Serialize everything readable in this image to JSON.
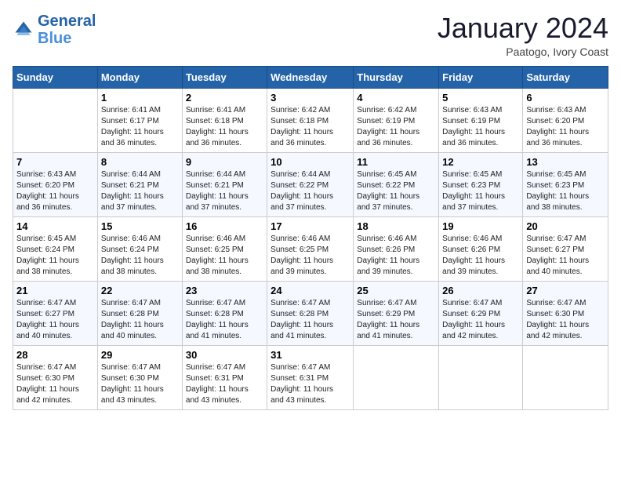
{
  "header": {
    "logo_line1": "General",
    "logo_line2": "Blue",
    "title": "January 2024",
    "subtitle": "Paatogo, Ivory Coast"
  },
  "days_of_week": [
    "Sunday",
    "Monday",
    "Tuesday",
    "Wednesday",
    "Thursday",
    "Friday",
    "Saturday"
  ],
  "weeks": [
    [
      {
        "day": "",
        "sunrise": "",
        "sunset": "",
        "daylight": ""
      },
      {
        "day": "1",
        "sunrise": "Sunrise: 6:41 AM",
        "sunset": "Sunset: 6:17 PM",
        "daylight": "Daylight: 11 hours and 36 minutes."
      },
      {
        "day": "2",
        "sunrise": "Sunrise: 6:41 AM",
        "sunset": "Sunset: 6:18 PM",
        "daylight": "Daylight: 11 hours and 36 minutes."
      },
      {
        "day": "3",
        "sunrise": "Sunrise: 6:42 AM",
        "sunset": "Sunset: 6:18 PM",
        "daylight": "Daylight: 11 hours and 36 minutes."
      },
      {
        "day": "4",
        "sunrise": "Sunrise: 6:42 AM",
        "sunset": "Sunset: 6:19 PM",
        "daylight": "Daylight: 11 hours and 36 minutes."
      },
      {
        "day": "5",
        "sunrise": "Sunrise: 6:43 AM",
        "sunset": "Sunset: 6:19 PM",
        "daylight": "Daylight: 11 hours and 36 minutes."
      },
      {
        "day": "6",
        "sunrise": "Sunrise: 6:43 AM",
        "sunset": "Sunset: 6:20 PM",
        "daylight": "Daylight: 11 hours and 36 minutes."
      }
    ],
    [
      {
        "day": "7",
        "sunrise": "Sunrise: 6:43 AM",
        "sunset": "Sunset: 6:20 PM",
        "daylight": "Daylight: 11 hours and 36 minutes."
      },
      {
        "day": "8",
        "sunrise": "Sunrise: 6:44 AM",
        "sunset": "Sunset: 6:21 PM",
        "daylight": "Daylight: 11 hours and 37 minutes."
      },
      {
        "day": "9",
        "sunrise": "Sunrise: 6:44 AM",
        "sunset": "Sunset: 6:21 PM",
        "daylight": "Daylight: 11 hours and 37 minutes."
      },
      {
        "day": "10",
        "sunrise": "Sunrise: 6:44 AM",
        "sunset": "Sunset: 6:22 PM",
        "daylight": "Daylight: 11 hours and 37 minutes."
      },
      {
        "day": "11",
        "sunrise": "Sunrise: 6:45 AM",
        "sunset": "Sunset: 6:22 PM",
        "daylight": "Daylight: 11 hours and 37 minutes."
      },
      {
        "day": "12",
        "sunrise": "Sunrise: 6:45 AM",
        "sunset": "Sunset: 6:23 PM",
        "daylight": "Daylight: 11 hours and 37 minutes."
      },
      {
        "day": "13",
        "sunrise": "Sunrise: 6:45 AM",
        "sunset": "Sunset: 6:23 PM",
        "daylight": "Daylight: 11 hours and 38 minutes."
      }
    ],
    [
      {
        "day": "14",
        "sunrise": "Sunrise: 6:45 AM",
        "sunset": "Sunset: 6:24 PM",
        "daylight": "Daylight: 11 hours and 38 minutes."
      },
      {
        "day": "15",
        "sunrise": "Sunrise: 6:46 AM",
        "sunset": "Sunset: 6:24 PM",
        "daylight": "Daylight: 11 hours and 38 minutes."
      },
      {
        "day": "16",
        "sunrise": "Sunrise: 6:46 AM",
        "sunset": "Sunset: 6:25 PM",
        "daylight": "Daylight: 11 hours and 38 minutes."
      },
      {
        "day": "17",
        "sunrise": "Sunrise: 6:46 AM",
        "sunset": "Sunset: 6:25 PM",
        "daylight": "Daylight: 11 hours and 39 minutes."
      },
      {
        "day": "18",
        "sunrise": "Sunrise: 6:46 AM",
        "sunset": "Sunset: 6:26 PM",
        "daylight": "Daylight: 11 hours and 39 minutes."
      },
      {
        "day": "19",
        "sunrise": "Sunrise: 6:46 AM",
        "sunset": "Sunset: 6:26 PM",
        "daylight": "Daylight: 11 hours and 39 minutes."
      },
      {
        "day": "20",
        "sunrise": "Sunrise: 6:47 AM",
        "sunset": "Sunset: 6:27 PM",
        "daylight": "Daylight: 11 hours and 40 minutes."
      }
    ],
    [
      {
        "day": "21",
        "sunrise": "Sunrise: 6:47 AM",
        "sunset": "Sunset: 6:27 PM",
        "daylight": "Daylight: 11 hours and 40 minutes."
      },
      {
        "day": "22",
        "sunrise": "Sunrise: 6:47 AM",
        "sunset": "Sunset: 6:28 PM",
        "daylight": "Daylight: 11 hours and 40 minutes."
      },
      {
        "day": "23",
        "sunrise": "Sunrise: 6:47 AM",
        "sunset": "Sunset: 6:28 PM",
        "daylight": "Daylight: 11 hours and 41 minutes."
      },
      {
        "day": "24",
        "sunrise": "Sunrise: 6:47 AM",
        "sunset": "Sunset: 6:28 PM",
        "daylight": "Daylight: 11 hours and 41 minutes."
      },
      {
        "day": "25",
        "sunrise": "Sunrise: 6:47 AM",
        "sunset": "Sunset: 6:29 PM",
        "daylight": "Daylight: 11 hours and 41 minutes."
      },
      {
        "day": "26",
        "sunrise": "Sunrise: 6:47 AM",
        "sunset": "Sunset: 6:29 PM",
        "daylight": "Daylight: 11 hours and 42 minutes."
      },
      {
        "day": "27",
        "sunrise": "Sunrise: 6:47 AM",
        "sunset": "Sunset: 6:30 PM",
        "daylight": "Daylight: 11 hours and 42 minutes."
      }
    ],
    [
      {
        "day": "28",
        "sunrise": "Sunrise: 6:47 AM",
        "sunset": "Sunset: 6:30 PM",
        "daylight": "Daylight: 11 hours and 42 minutes."
      },
      {
        "day": "29",
        "sunrise": "Sunrise: 6:47 AM",
        "sunset": "Sunset: 6:30 PM",
        "daylight": "Daylight: 11 hours and 43 minutes."
      },
      {
        "day": "30",
        "sunrise": "Sunrise: 6:47 AM",
        "sunset": "Sunset: 6:31 PM",
        "daylight": "Daylight: 11 hours and 43 minutes."
      },
      {
        "day": "31",
        "sunrise": "Sunrise: 6:47 AM",
        "sunset": "Sunset: 6:31 PM",
        "daylight": "Daylight: 11 hours and 43 minutes."
      },
      {
        "day": "",
        "sunrise": "",
        "sunset": "",
        "daylight": ""
      },
      {
        "day": "",
        "sunrise": "",
        "sunset": "",
        "daylight": ""
      },
      {
        "day": "",
        "sunrise": "",
        "sunset": "",
        "daylight": ""
      }
    ]
  ]
}
